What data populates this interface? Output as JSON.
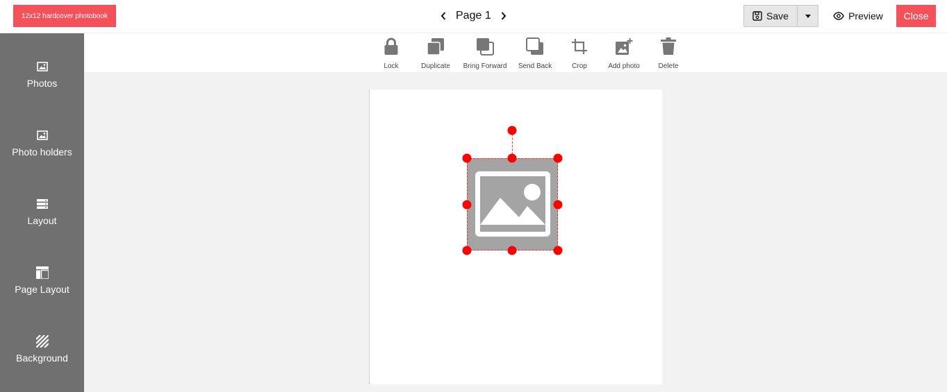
{
  "header": {
    "product": "12x12 hardcover photobook",
    "page_label": "Page 1",
    "save_label": "Save",
    "preview_label": "Preview",
    "close_label": "Close"
  },
  "sidebar": {
    "items": [
      {
        "label": "Photos",
        "icon": "image-icon"
      },
      {
        "label": "Photo holders",
        "icon": "image-icon"
      },
      {
        "label": "Layout",
        "icon": "layout-list-icon"
      },
      {
        "label": "Page Layout",
        "icon": "page-layout-icon"
      },
      {
        "label": "Background",
        "icon": "stripes-icon"
      }
    ]
  },
  "toolbar": {
    "tools": [
      {
        "label": "Lock",
        "icon": "lock-icon"
      },
      {
        "label": "Duplicate",
        "icon": "duplicate-icon"
      },
      {
        "label": "Bring Forward",
        "icon": "bring-forward-icon"
      },
      {
        "label": "Send Back",
        "icon": "send-back-icon"
      },
      {
        "label": "Crop",
        "icon": "crop-icon"
      },
      {
        "label": "Add photo",
        "icon": "add-photo-icon"
      },
      {
        "label": "Delete",
        "icon": "trash-icon"
      }
    ]
  },
  "colors": {
    "accent": "#f4515a",
    "sidebar": "#707070",
    "selection": "#ff0000",
    "placeholder": "#a4a4a4"
  }
}
